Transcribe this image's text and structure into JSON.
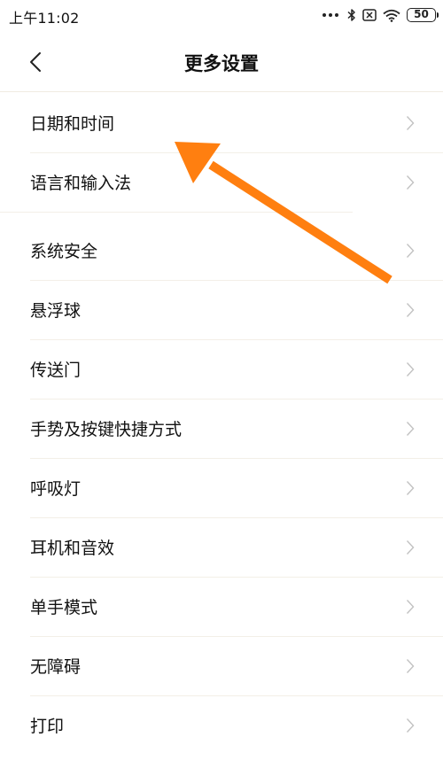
{
  "status_bar": {
    "time": "上午11:02",
    "battery": "50"
  },
  "header": {
    "title": "更多设置",
    "back_icon": "chevron-left-icon"
  },
  "groups": [
    {
      "items": [
        {
          "label": "日期和时间"
        },
        {
          "label": "语言和输入法"
        }
      ]
    },
    {
      "items": [
        {
          "label": "系统安全"
        },
        {
          "label": "悬浮球"
        },
        {
          "label": "传送门"
        },
        {
          "label": "手势及按键快捷方式"
        },
        {
          "label": "呼吸灯"
        },
        {
          "label": "耳机和音效"
        },
        {
          "label": "单手模式"
        },
        {
          "label": "无障碍"
        },
        {
          "label": "打印"
        }
      ]
    }
  ],
  "colors": {
    "arrow": "#FF7F10",
    "chevron": "#c2c2c2",
    "divider": "#f3efe7"
  }
}
